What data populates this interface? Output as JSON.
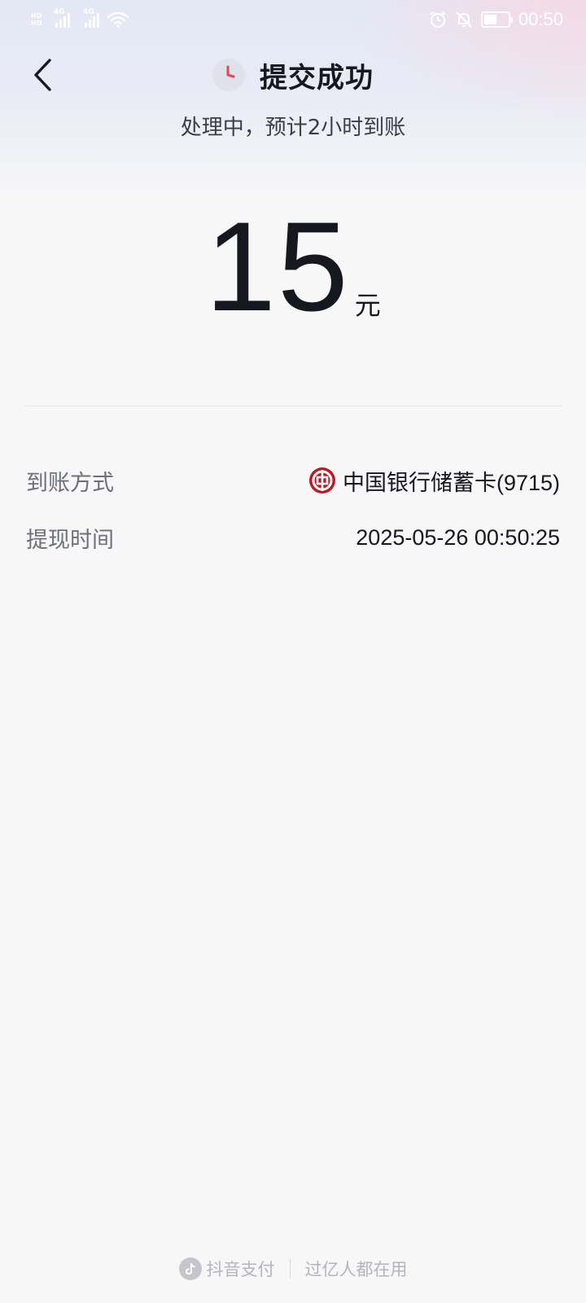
{
  "status_bar": {
    "network_1": "4G",
    "network_2": "4G",
    "time": "00:50"
  },
  "header": {
    "title": "提交成功",
    "subtitle": "处理中，预计2小时到账"
  },
  "amount": {
    "value": "15",
    "unit": "元"
  },
  "details": [
    {
      "label": "到账方式",
      "value": "中国银行储蓄卡(9715)",
      "icon": "bank-of-china-icon"
    },
    {
      "label": "提现时间",
      "value": "2025-05-26 00:50:25"
    }
  ],
  "footer": {
    "brand": "抖音支付",
    "slogan": "过亿人都在用"
  },
  "colors": {
    "text_primary": "#16181f",
    "text_secondary": "#6d707a",
    "clock_accent": "#e8455b",
    "bank_red": "#b81c22",
    "background": "#f7f7f8"
  }
}
